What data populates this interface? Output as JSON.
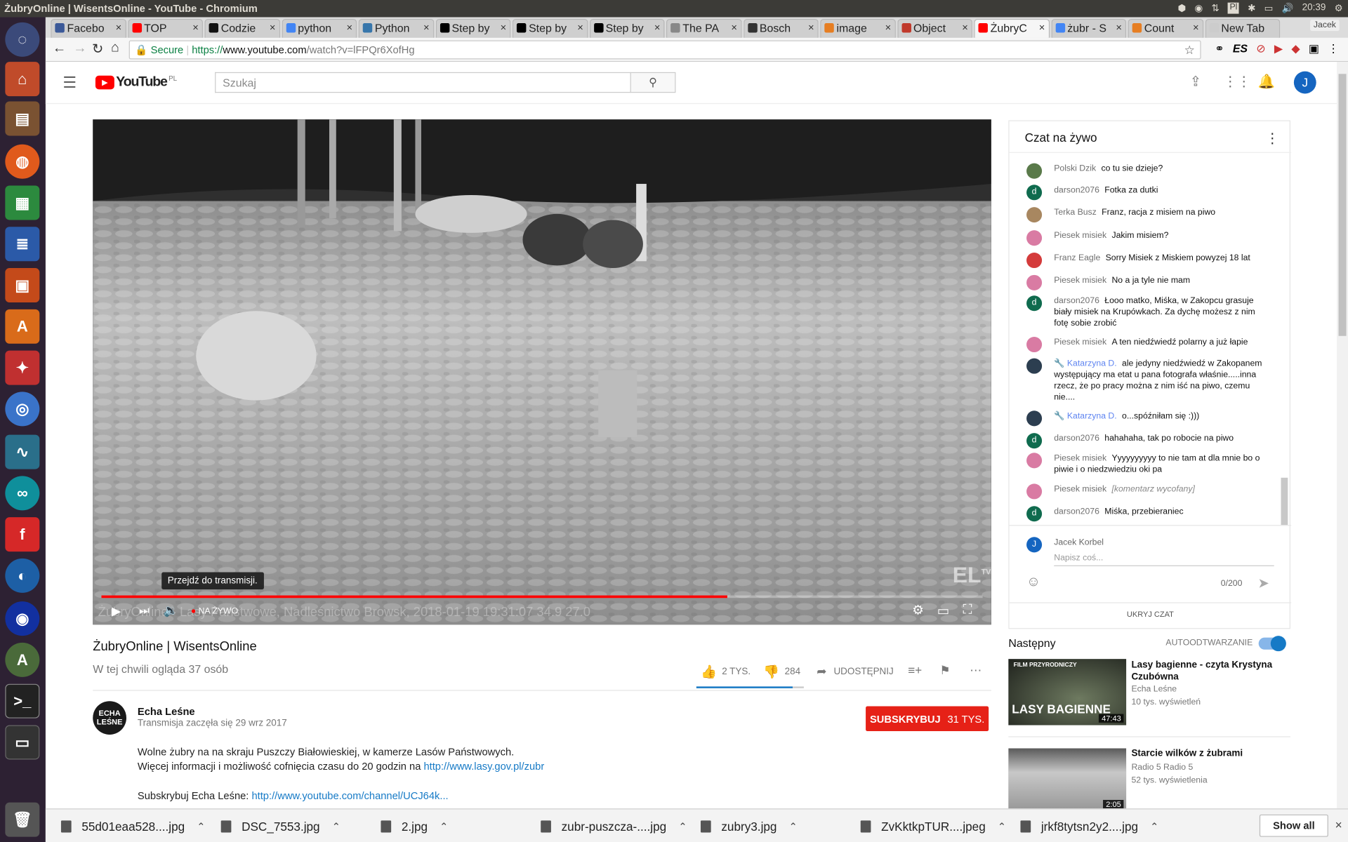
{
  "window": {
    "title": "ŻubryOnline | WisentsOnline - YouTube - Chromium",
    "time": "20:39",
    "keyboard_layout": "Pl"
  },
  "tabs": [
    {
      "label": "Facebo",
      "color": "#3b5998"
    },
    {
      "label": "TOP",
      "color": "#ff0000"
    },
    {
      "label": "Codzie",
      "color": "#111111"
    },
    {
      "label": "python",
      "color": "#4285f4"
    },
    {
      "label": "Python",
      "color": "#3776ab"
    },
    {
      "label": "Step by",
      "color": "#000000"
    },
    {
      "label": "Step by",
      "color": "#000000"
    },
    {
      "label": "Step by",
      "color": "#000000"
    },
    {
      "label": "The PA",
      "color": "#888888"
    },
    {
      "label": "Bosch",
      "color": "#333333"
    },
    {
      "label": "image",
      "color": "#e67e22"
    },
    {
      "label": "Object",
      "color": "#c0392b"
    },
    {
      "label": "ŻubryC",
      "color": "#ff0000"
    },
    {
      "label": "żubr - S",
      "color": "#4285f4"
    },
    {
      "label": "Count",
      "color": "#e67e22"
    },
    {
      "label": "New Tab",
      "color": "#cccccc"
    }
  ],
  "address": {
    "secure_label": "Secure",
    "url_scheme": "https://",
    "url_host": "www.youtube.com",
    "url_path": "/watch?v=lFPQr6XofHg",
    "profile": "Jacek"
  },
  "youtube": {
    "logo": "YouTube",
    "logo_region": "PL",
    "search_placeholder": "Szukaj",
    "user_initial": "J"
  },
  "player": {
    "tooltip": "Przejdź do transmisji.",
    "live_label": "NA ŻYWO",
    "overlay_text": "ŻubryOnline - Lasy Państwowe, Nadleśnictwo Browsk, 2018-01-19 19:31:07 34.9 27.0",
    "watermark": "EL",
    "watermark_sup": "TV",
    "progress": 0.71
  },
  "video": {
    "title": "ŻubryOnline | WisentsOnline",
    "viewers": "W tej chwili ogląda 37 osób",
    "likes": "2 TYS.",
    "dislikes": "284",
    "share_label": "UDOSTĘPNIJ",
    "channel_name": "Echa Leśne",
    "channel_logo_text": "ECHA LEŚNE",
    "published": "Transmisja zaczęła się 29 wrz 2017",
    "subscribe_label": "SUBSKRYBUJ",
    "subscribe_count": "31 TYS.",
    "description_line1": "Wolne żubry na na skraju Puszczy Białowieskiej, w kamerze Lasów Państwowych.",
    "description_line2_text": "Więcej informacji i możliwość cofnięcia czasu do 20 godzin na ",
    "description_line2_link": "http://www.lasy.gov.pl/zubr",
    "description_line3_text": "Subskrybuj Echa Leśne: ",
    "description_line3_link": "http://www.youtube.com/channel/UCJ64k..."
  },
  "chat": {
    "title": "Czat na żywo",
    "messages": [
      {
        "author": "Polski Dzik",
        "text": "co tu sie dzieje?",
        "avatar_color": "#5a7a4a",
        "initial": ""
      },
      {
        "author": "darson2076",
        "text": "Fotka za dutki",
        "avatar_color": "#0f6b4e",
        "initial": "d"
      },
      {
        "author": "Terka Busz",
        "text": "Franz, racja z misiem na piwo",
        "avatar_color": "#a88760",
        "initial": ""
      },
      {
        "author": "Piesek misiek",
        "text": "Jakim misiem?",
        "avatar_color": "#d97ba3",
        "initial": ""
      },
      {
        "author": "Franz Eagle",
        "text": "Sorry Misiek z Miskiem powyzej 18 lat",
        "avatar_color": "#d43b3b",
        "initial": ""
      },
      {
        "author": "Piesek misiek",
        "text": "No a ja tyle nie mam",
        "avatar_color": "#d97ba3",
        "initial": ""
      },
      {
        "author": "darson2076",
        "text": "Łooo matko, Miśka, w Zakopcu grasuje biały misiek na Krupówkach. Za dychę możesz z nim fotę sobie zrobić",
        "avatar_color": "#0f6b4e",
        "initial": "d"
      },
      {
        "author": "Piesek misiek",
        "text": "A ten niedźwiedź polarny a już łapie",
        "avatar_color": "#d97ba3",
        "initial": ""
      },
      {
        "author": "Katarzyna D.",
        "text": "ale jedyny niedźwiedź w Zakopanem występujący ma etat u pana fotografa właśnie.....inna rzecz, że po pracy można z nim iść na piwo, czemu nie....",
        "avatar_color": "#2c3e50",
        "initial": "",
        "moderator": true
      },
      {
        "author": "Katarzyna D.",
        "text": "o...spóźniłam się :)))",
        "avatar_color": "#2c3e50",
        "initial": "",
        "moderator": true
      },
      {
        "author": "darson2076",
        "text": "hahahaha, tak po robocie na piwo",
        "avatar_color": "#0f6b4e",
        "initial": "d"
      },
      {
        "author": "Piesek misiek",
        "text": "Yyyyyyyyyy to nie tam at dla mnie bo o piwie i o niedzwiedziu oki pa",
        "avatar_color": "#d97ba3",
        "initial": ""
      },
      {
        "author": "Piesek misiek",
        "text": "[komentarz wycofany]",
        "avatar_color": "#d97ba3",
        "initial": "",
        "retracted": true
      },
      {
        "author": "darson2076",
        "text": "Miśka, przebieraniec",
        "avatar_color": "#0f6b4e",
        "initial": "d"
      }
    ],
    "input_user": "Jacek Korbel",
    "input_user_initial": "J",
    "input_placeholder": "Napisz coś...",
    "char_count": "0/200",
    "hide_label": "UKRYJ CZAT"
  },
  "up_next": {
    "label": "Następny",
    "autoplay_label": "AUTOODTWARZANIE",
    "autoplay_on": true,
    "videos": [
      {
        "title": "Lasy bagienne - czyta Krystyna Czubówna",
        "channel": "Echa Leśne",
        "views": "10 tys. wyświetleń",
        "duration": "47:43",
        "thumb_top": "FILM PRZYRODNICZY",
        "thumb_main": "LASY BAGIENNE"
      },
      {
        "title": "Starcie wilków z żubrami",
        "channel": "Radio 5 Radio 5",
        "views": "52 tys. wyświetlenia",
        "duration": "2:05"
      }
    ]
  },
  "downloads": {
    "items": [
      "55d01eaa528....jpg",
      "DSC_7553.jpg",
      "2.jpg",
      "zubr-puszcza-....jpg",
      "zubry3.jpg",
      "ZvKktkpTUR....jpeg",
      "jrkf8tytsn2y2....jpg"
    ],
    "show_all_label": "Show all"
  }
}
